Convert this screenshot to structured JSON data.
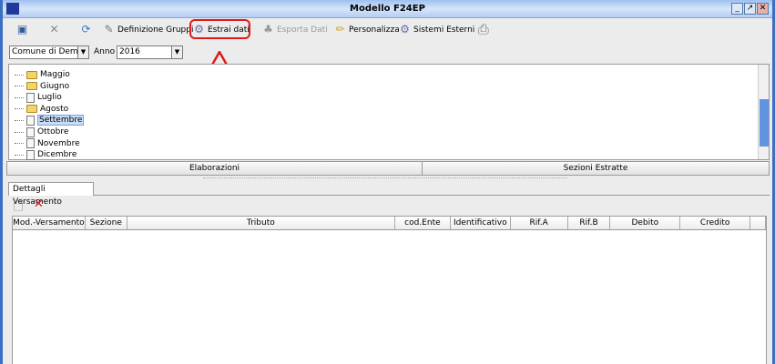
{
  "window": {
    "title": "Modello F24EP",
    "buttons": [
      "_",
      "↗",
      "✕"
    ]
  },
  "toolbar": {
    "definizione": "Definizione Gruppi",
    "estrai": "Estrai dati",
    "esporta": "Esporta Dati",
    "personalizza": "Personalizza",
    "sistemi": "Sistemi Esterni"
  },
  "filters": {
    "comune": "Comune di Demo",
    "anno_label": "Anno",
    "anno": "2016"
  },
  "tree": {
    "items": [
      {
        "label": "Maggio",
        "type": "folder"
      },
      {
        "label": "Giugno",
        "type": "folder"
      },
      {
        "label": "Luglio",
        "type": "doc"
      },
      {
        "label": "Agosto",
        "type": "folder"
      },
      {
        "label": "Settembre",
        "type": "doc",
        "selected": true
      },
      {
        "label": "Ottobre",
        "type": "doc"
      },
      {
        "label": "Novembre",
        "type": "doc"
      },
      {
        "label": "Dicembre",
        "type": "doc"
      }
    ]
  },
  "sections": {
    "elaborazioni": "Elaborazioni",
    "estratte": "Sezioni Estratte"
  },
  "tab": "Dettagli Versamento",
  "table": {
    "columns": [
      "Mod.-Versamento",
      "Sezione",
      "Tributo",
      "cod.Ente",
      "Identificativo",
      "Rif.A",
      "Rif.B",
      "Debito",
      "Credito"
    ]
  },
  "colors": {
    "highlight": "#e01b1b",
    "title": "#b4cdf2"
  }
}
